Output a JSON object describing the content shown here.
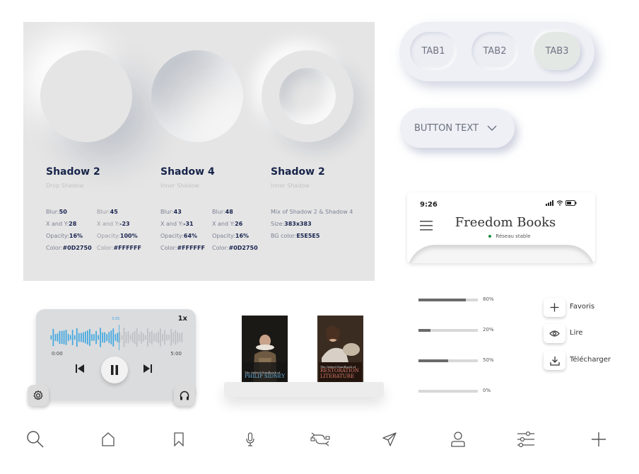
{
  "shadow_panel": {
    "columns": [
      {
        "title": "Shadow 2",
        "subtitle": "Drop Shadow",
        "specs_a": [
          {
            "label": "Blur:",
            "value": "50"
          },
          {
            "label": "X and Y:",
            "value": "28"
          },
          {
            "label": "Opacity:",
            "value": "16%"
          },
          {
            "label": "Color:",
            "value": "#0D2750"
          }
        ],
        "specs_b": [
          {
            "label": "Blur:",
            "value": "45"
          },
          {
            "label": "X and Y:",
            "value": "-23"
          },
          {
            "label": "Opacity:",
            "value": "100%"
          },
          {
            "label": "Color:",
            "value": "#FFFFFF"
          }
        ]
      },
      {
        "title": "Shadow 4",
        "subtitle": "Inner Shadow",
        "specs_a": [
          {
            "label": "Blur:",
            "value": "43"
          },
          {
            "label": "X and Y:",
            "value": "-31"
          },
          {
            "label": "Opacity:",
            "value": "64%"
          },
          {
            "label": "Color:",
            "value": "#FFFFFF"
          }
        ],
        "specs_b": [
          {
            "label": "Blur:",
            "value": "48"
          },
          {
            "label": "X and Y:",
            "value": "26"
          },
          {
            "label": "Opacity:",
            "value": "16%"
          },
          {
            "label": "Color:",
            "value": "#0D2750"
          }
        ]
      },
      {
        "title": "Shadow 2",
        "subtitle": "Inner Shadow",
        "note": "Mix of  Shadow 2  & Shadow 4",
        "specs_a": [
          {
            "label": "Size:",
            "value": "383x383"
          },
          {
            "label": "BG color:",
            "value": "E5E5E5"
          }
        ]
      }
    ]
  },
  "tabs": [
    "TAB1",
    "TAB2",
    "TAB3"
  ],
  "active_tab": "TAB3",
  "dropdown_button": {
    "label": "BUTTON TEXT",
    "icon": "chevron-down-icon"
  },
  "phone": {
    "time": "9:26",
    "title": "Freedom Books",
    "network_status": "Réseau stable",
    "network_color": "#1e8a42"
  },
  "player": {
    "speed": "1x",
    "marker": "3:55",
    "start_time": "0:00",
    "end_time": "5:00",
    "progress": 0.52,
    "accent": "#3fa7e0"
  },
  "books": [
    {
      "header": "The Oxford Handbook of",
      "title": "PHILIP SIDNEY",
      "title_color": "#6ab7e4"
    },
    {
      "header": "The Oxford Handbook of",
      "title": "RESTORATION LITERATURE",
      "title_color": "#d77a6a"
    }
  ],
  "progress_bars": [
    {
      "label": "80%",
      "value": 0.8
    },
    {
      "label": "20%",
      "value": 0.2
    },
    {
      "label": "50%",
      "value": 0.5
    },
    {
      "label": "0%",
      "value": 0
    }
  ],
  "actions": [
    {
      "label": "Favoris",
      "icon": "plus-icon"
    },
    {
      "label": "Lire",
      "icon": "eye-icon"
    },
    {
      "label": "Télécharger",
      "icon": "download-icon"
    }
  ],
  "bottom_nav": [
    "search-icon",
    "home-icon",
    "bookmark-icon",
    "microphone-icon",
    "exchange-icon",
    "send-icon",
    "user-icon",
    "sliders-icon",
    "plus-icon"
  ]
}
